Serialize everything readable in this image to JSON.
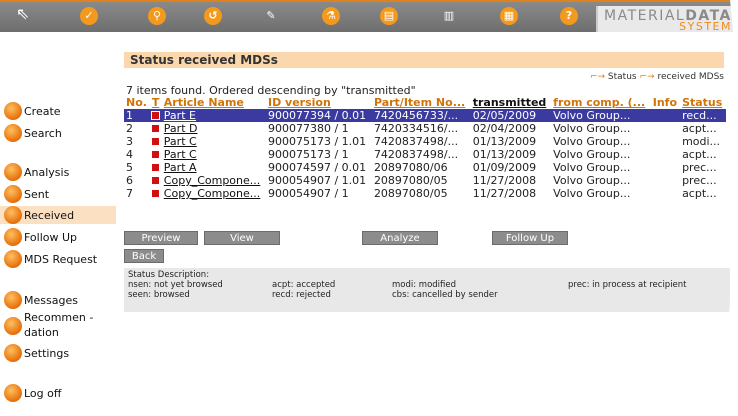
{
  "app": {
    "logo_line1a": "MATERIAL",
    "logo_line1b": "DATA",
    "logo_line2": "SYSTEM"
  },
  "toolbar": {
    "icons": [
      "check-icon",
      "search-icon",
      "refresh-icon",
      "pen-icon",
      "flask-icon",
      "docs-icon",
      "copy-icon",
      "print-icon",
      "help-icon"
    ],
    "glyphs": [
      "✓",
      "⚲",
      "↺",
      "✎",
      "⚗",
      "▤",
      "▥",
      "▦",
      "?"
    ],
    "accent": "#f39a1e"
  },
  "sidebar": {
    "items": [
      "Create",
      "Search",
      "Analysis",
      "Sent",
      "Received",
      "Follow Up",
      "MDS Request",
      "Messages",
      "Recommen -",
      "dation",
      "Settings",
      "Log off"
    ]
  },
  "page": {
    "title": "Status received MDSs",
    "found": "7 items found. Ordered descending by \"transmitted\"",
    "legend_status": "Status",
    "legend_received": "received MDSs"
  },
  "table": {
    "headers": [
      "No.",
      "T",
      "Article Name",
      "ID version",
      "Part/Item No...",
      "transmitted",
      "from comp. (...",
      "Info",
      "Status"
    ],
    "rows": [
      [
        "1",
        "",
        "Part E",
        "900077394 / 0.01",
        "7420456733/...",
        "02/05/2009",
        "Volvo Group...",
        "",
        "recd..."
      ],
      [
        "2",
        "",
        "Part D",
        "900077380 / 1",
        "7420334516/...",
        "02/04/2009",
        "Volvo Group...",
        "",
        "acpt..."
      ],
      [
        "3",
        "",
        "Part C",
        "900075173 / 1.01",
        "7420837498/...",
        "01/13/2009",
        "Volvo Group...",
        "",
        "modi..."
      ],
      [
        "4",
        "",
        "Part C",
        "900075173 / 1",
        "7420837498/...",
        "01/13/2009",
        "Volvo Group...",
        "",
        "acpt..."
      ],
      [
        "5",
        "",
        "Part A",
        "900074597 / 0.01",
        "20897080/06",
        "01/09/2009",
        "Volvo Group...",
        "",
        "prec..."
      ],
      [
        "6",
        "",
        "Copy_Compone...",
        "900054907 / 1.01",
        "20897080/05",
        "11/27/2008",
        "Volvo Group...",
        "",
        "prec..."
      ],
      [
        "7",
        "",
        "Copy_Compone...",
        "900054907 / 1",
        "20897080/05",
        "11/27/2008",
        "Volvo Group...",
        "",
        "acpt..."
      ]
    ]
  },
  "buttons": {
    "preview": "Preview",
    "view": "View",
    "analyze": "Analyze",
    "followup": "Follow Up",
    "back": "Back"
  },
  "status_desc": {
    "title": "Status Description:",
    "nsen": "nsen: not yet browsed",
    "seen": "seen: browsed",
    "acpt": "acpt: accepted",
    "recd": "recd: rejected",
    "modi": "modi: modified",
    "cbs": "cbs: cancelled by sender",
    "prec": "prec: in process at recipient"
  }
}
